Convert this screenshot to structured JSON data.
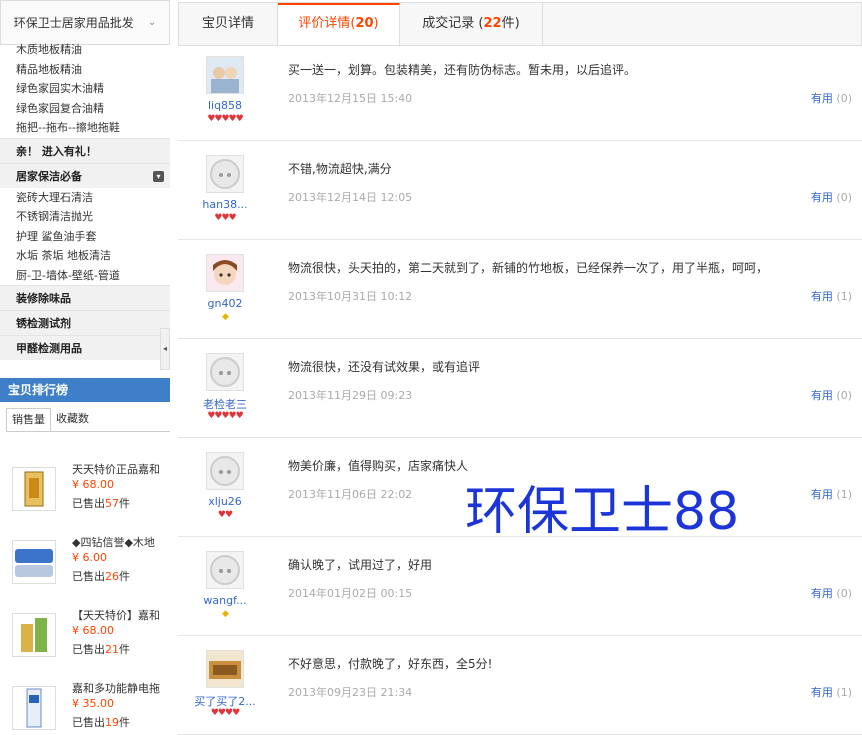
{
  "shop": {
    "name": "环保卫士居家用品批发",
    "chevron": "⌄"
  },
  "categories": {
    "items_top": [
      "木质地板精油",
      "精品地板精油",
      "绿色家园实木油精",
      "绿色家园复合油精",
      "拖把--拖布--擦地拖鞋"
    ],
    "head_1": "亲！ 进入有礼！",
    "head_2": "居家保洁必备",
    "items_mid": [
      "瓷砖大理石清洁",
      "不锈钢清洁抛光",
      "护理 鲨鱼油手套",
      "水垢 茶垢 地板清洁",
      "厨-卫-墙体-壁纸-管道"
    ],
    "head_3": "装修除味品",
    "head_4": "锈检测试剂",
    "head_5": "甲醛检测用品",
    "collapse_arrow": "◂",
    "toggle_icon": "▾"
  },
  "ranking": {
    "title": "宝贝排行榜",
    "tabs": [
      "销售量",
      "收藏数"
    ],
    "products": [
      {
        "name": "天天特价正品嘉和",
        "price": "¥ 68.00",
        "sold_prefix": "已售出",
        "sold": "57",
        "sold_suffix": "件"
      },
      {
        "name": "◆四钻信誉◆木地",
        "price": "¥ 6.00",
        "sold_prefix": "已售出",
        "sold": "26",
        "sold_suffix": "件"
      },
      {
        "name": "【天天特价】嘉和",
        "price": "¥ 68.00",
        "sold_prefix": "已售出",
        "sold": "21",
        "sold_suffix": "件"
      },
      {
        "name": "嘉和多功能静电拖",
        "price": "¥ 35.00",
        "sold_prefix": "已售出",
        "sold": "19",
        "sold_suffix": "件"
      }
    ]
  },
  "tabs": {
    "details": "宝贝详情",
    "reviews_label": "评价详情(",
    "reviews_count": "20",
    "reviews_close": ")",
    "deals_label": "成交记录 (",
    "deals_count": "22",
    "deals_suffix": "件)"
  },
  "reviews": [
    {
      "nick": "liq858",
      "badges": "♥♥♥♥♥",
      "badge_type": "heart",
      "text": "买一送一，划算。包装精美，还有防伪标志。暂未用，以后追评。",
      "date": "2013年12月15日 15:40",
      "useful": "有用",
      "useful_count": "(0)"
    },
    {
      "nick": "han38...",
      "badges": "♥♥♥",
      "badge_type": "heart",
      "text": "不错,物流超快,满分",
      "date": "2013年12月14日 12:05",
      "useful": "有用",
      "useful_count": "(0)"
    },
    {
      "nick": "gn402",
      "badges": "◆",
      "badge_type": "diamond",
      "text": "物流很快，头天拍的，第二天就到了，新铺的竹地板，已经保养一次了，用了半瓶，呵呵，",
      "date": "2013年10月31日 10:12",
      "useful": "有用",
      "useful_count": "(1)"
    },
    {
      "nick": "老检老三",
      "badges": "♥♥♥♥♥",
      "badge_type": "heart",
      "text": "物流很快，还没有试效果，或有追评",
      "date": "2013年11月29日 09:23",
      "useful": "有用",
      "useful_count": "(0)"
    },
    {
      "nick": "xlju26",
      "badges": "♥♥",
      "badge_type": "heart",
      "text": "物美价廉，值得购买，店家痛快人",
      "date": "2013年11月06日 22:02",
      "useful": "有用",
      "useful_count": "(1)"
    },
    {
      "nick": "wangf...",
      "badges": "◆",
      "badge_type": "diamond",
      "text": "确认晚了，试用过了，好用",
      "date": "2014年01月02日 00:15",
      "useful": "有用",
      "useful_count": "(0)"
    },
    {
      "nick": "买了买了2...",
      "badges": "♥♥♥♥",
      "badge_type": "heart",
      "text": "不好意思，付款晚了，好东西，全5分!",
      "date": "2013年09月23日 21:34",
      "useful": "有用",
      "useful_count": "(1)"
    }
  ],
  "watermark": "环保卫士88"
}
